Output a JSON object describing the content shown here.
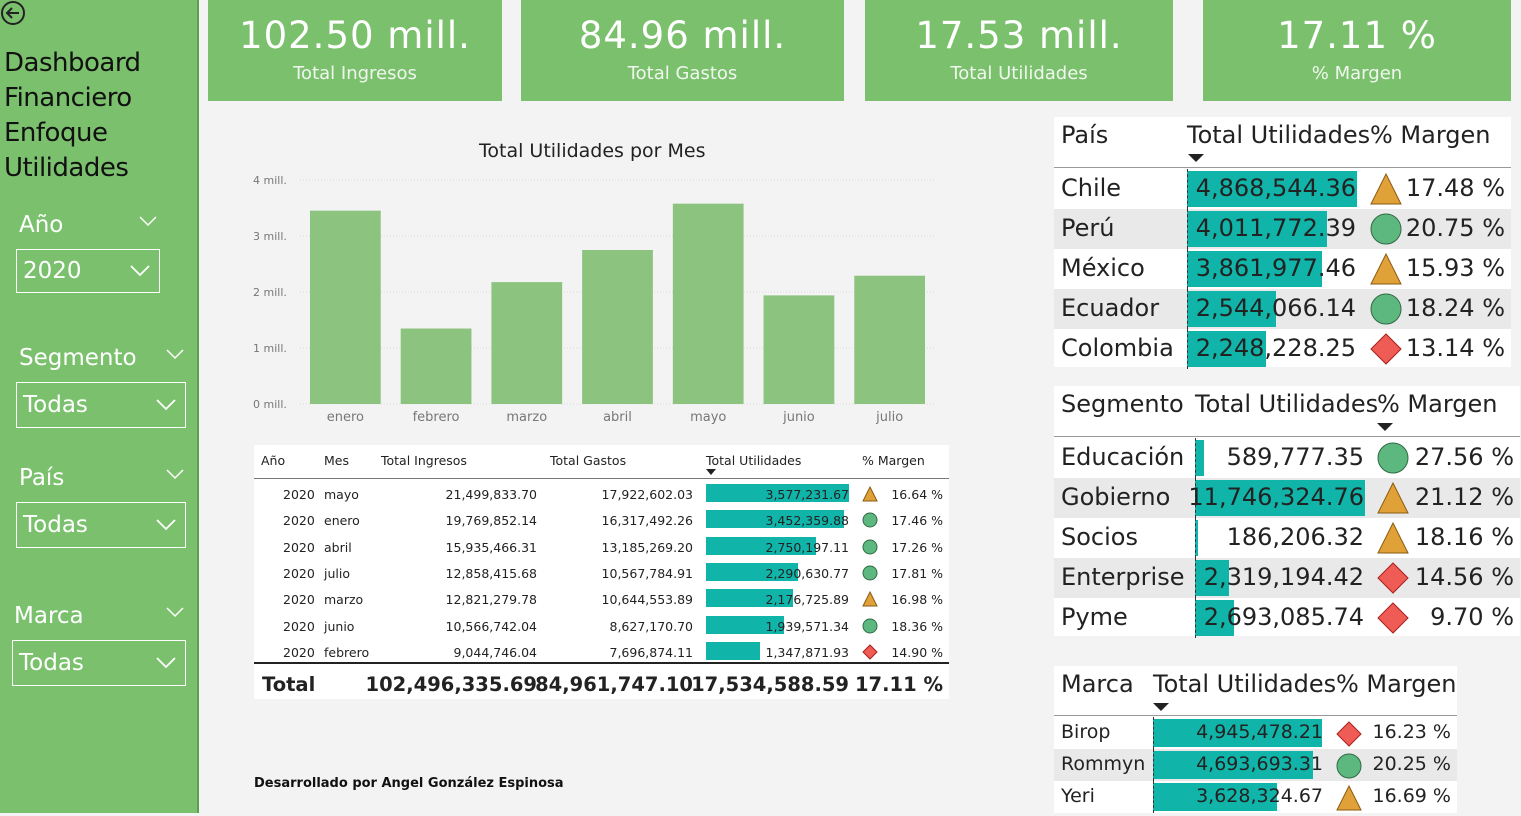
{
  "sidebar": {
    "title": "Dashboard Financiero Enfoque Utilidades",
    "filters": [
      {
        "label": "Año",
        "value": "2020"
      },
      {
        "label": "Segmento",
        "value": "Todas"
      },
      {
        "label": "País",
        "value": "Todas"
      },
      {
        "label": "Marca",
        "value": "Todas"
      }
    ]
  },
  "kpis": [
    {
      "value": "102.50 mill.",
      "label": "Total Ingresos"
    },
    {
      "value": "84.96 mill.",
      "label": "Total Gastos"
    },
    {
      "value": "17.53 mill.",
      "label": "Total Utilidades"
    },
    {
      "value": "17.11 %",
      "label": "% Margen"
    }
  ],
  "chart_data": {
    "type": "bar",
    "title": "Total Utilidades por Mes",
    "categories": [
      "enero",
      "febrero",
      "marzo",
      "abril",
      "mayo",
      "junio",
      "julio"
    ],
    "values": [
      3452359.88,
      1347871.93,
      2176725.89,
      2750197.11,
      3577231.67,
      1939571.34,
      2290630.77
    ],
    "ylim": [
      0,
      4000000
    ],
    "yticks": [
      "0 mill.",
      "1 mill.",
      "2 mill.",
      "3 mill.",
      "4 mill."
    ],
    "grid": true,
    "color": "#8cc37e"
  },
  "month_table": {
    "headers": [
      "Año",
      "Mes",
      "Total Ingresos",
      "Total Gastos",
      "Total Utilidades",
      "% Margen"
    ],
    "rows": [
      {
        "anio": "2020",
        "mes": "mayo",
        "ingresos": "21,499,833.70",
        "gastos": "17,922,602.03",
        "utilidades": "3,577,231.67",
        "util_value": 3577231.67,
        "margen": "16.64 %",
        "icon": "triangle"
      },
      {
        "anio": "2020",
        "mes": "enero",
        "ingresos": "19,769,852.14",
        "gastos": "16,317,492.26",
        "utilidades": "3,452,359.88",
        "util_value": 3452359.88,
        "margen": "17.46 %",
        "icon": "circle"
      },
      {
        "anio": "2020",
        "mes": "abril",
        "ingresos": "15,935,466.31",
        "gastos": "13,185,269.20",
        "utilidades": "2,750,197.11",
        "util_value": 2750197.11,
        "margen": "17.26 %",
        "icon": "circle"
      },
      {
        "anio": "2020",
        "mes": "julio",
        "ingresos": "12,858,415.68",
        "gastos": "10,567,784.91",
        "utilidades": "2,290,630.77",
        "util_value": 2290630.77,
        "margen": "17.81 %",
        "icon": "circle"
      },
      {
        "anio": "2020",
        "mes": "marzo",
        "ingresos": "12,821,279.78",
        "gastos": "10,644,553.89",
        "utilidades": "2,176,725.89",
        "util_value": 2176725.89,
        "margen": "16.98 %",
        "icon": "triangle"
      },
      {
        "anio": "2020",
        "mes": "junio",
        "ingresos": "10,566,742.04",
        "gastos": "8,627,170.70",
        "utilidades": "1,939,571.34",
        "util_value": 1939571.34,
        "margen": "18.36 %",
        "icon": "circle"
      },
      {
        "anio": "2020",
        "mes": "febrero",
        "ingresos": "9,044,746.04",
        "gastos": "7,696,874.11",
        "utilidades": "1,347,871.93",
        "util_value": 1347871.93,
        "margen": "14.90 %",
        "icon": "diamond"
      }
    ],
    "total": {
      "label": "Total",
      "ingresos": "102,496,335.69",
      "gastos": "84,961,747.10",
      "utilidades": "17,534,588.59",
      "margen": "17.11 %"
    }
  },
  "pais_table": {
    "headers": [
      "País",
      "Total Utilidades",
      "% Margen"
    ],
    "rows": [
      {
        "name": "Chile",
        "utilidades": "4,868,544.36",
        "util_value": 4868544.36,
        "margen": "17.48 %",
        "icon": "triangle"
      },
      {
        "name": "Perú",
        "utilidades": "4,011,772.39",
        "util_value": 4011772.39,
        "margen": "20.75 %",
        "icon": "circle"
      },
      {
        "name": "México",
        "utilidades": "3,861,977.46",
        "util_value": 3861977.46,
        "margen": "15.93 %",
        "icon": "triangle"
      },
      {
        "name": "Ecuador",
        "utilidades": "2,544,066.14",
        "util_value": 2544066.14,
        "margen": "18.24 %",
        "icon": "circle"
      },
      {
        "name": "Colombia",
        "utilidades": "2,248,228.25",
        "util_value": 2248228.25,
        "margen": "13.14 %",
        "icon": "diamond"
      }
    ]
  },
  "segmento_table": {
    "headers": [
      "Segmento",
      "Total Utilidades",
      "% Margen"
    ],
    "rows": [
      {
        "name": "Educación",
        "utilidades": "589,777.35",
        "util_value": 589777.35,
        "margen": "27.56 %",
        "icon": "circle"
      },
      {
        "name": "Gobierno",
        "utilidades": "11,746,324.76",
        "util_value": 11746324.76,
        "margen": "21.12 %",
        "icon": "triangle"
      },
      {
        "name": "Socios",
        "utilidades": "186,206.32",
        "util_value": 186206.32,
        "margen": "18.16 %",
        "icon": "triangle"
      },
      {
        "name": "Enterprise",
        "utilidades": "2,319,194.42",
        "util_value": 2319194.42,
        "margen": "14.56 %",
        "icon": "diamond"
      },
      {
        "name": "Pyme",
        "utilidades": "2,693,085.74",
        "util_value": 2693085.74,
        "margen": "9.70 %",
        "icon": "diamond"
      }
    ]
  },
  "marca_table": {
    "headers": [
      "Marca",
      "Total Utilidades",
      "% Margen"
    ],
    "rows": [
      {
        "name": "Birop",
        "utilidades": "4,945,478.21",
        "util_value": 4945478.21,
        "margen": "16.23 %",
        "icon": "diamond"
      },
      {
        "name": "Rommyn",
        "utilidades": "4,693,693.31",
        "util_value": 4693693.31,
        "margen": "20.25 %",
        "icon": "circle"
      },
      {
        "name": "Yeri",
        "utilidades": "3,628,324.67",
        "util_value": 3628324.67,
        "margen": "16.69 %",
        "icon": "triangle"
      }
    ]
  },
  "footer": "Desarrollado por Angel González Espinosa",
  "colors": {
    "green": "#7bc16d",
    "teal": "#11b4a8",
    "triangle": "#e0a238",
    "circle": "#5cb87e",
    "diamond": "#ef5b55"
  }
}
